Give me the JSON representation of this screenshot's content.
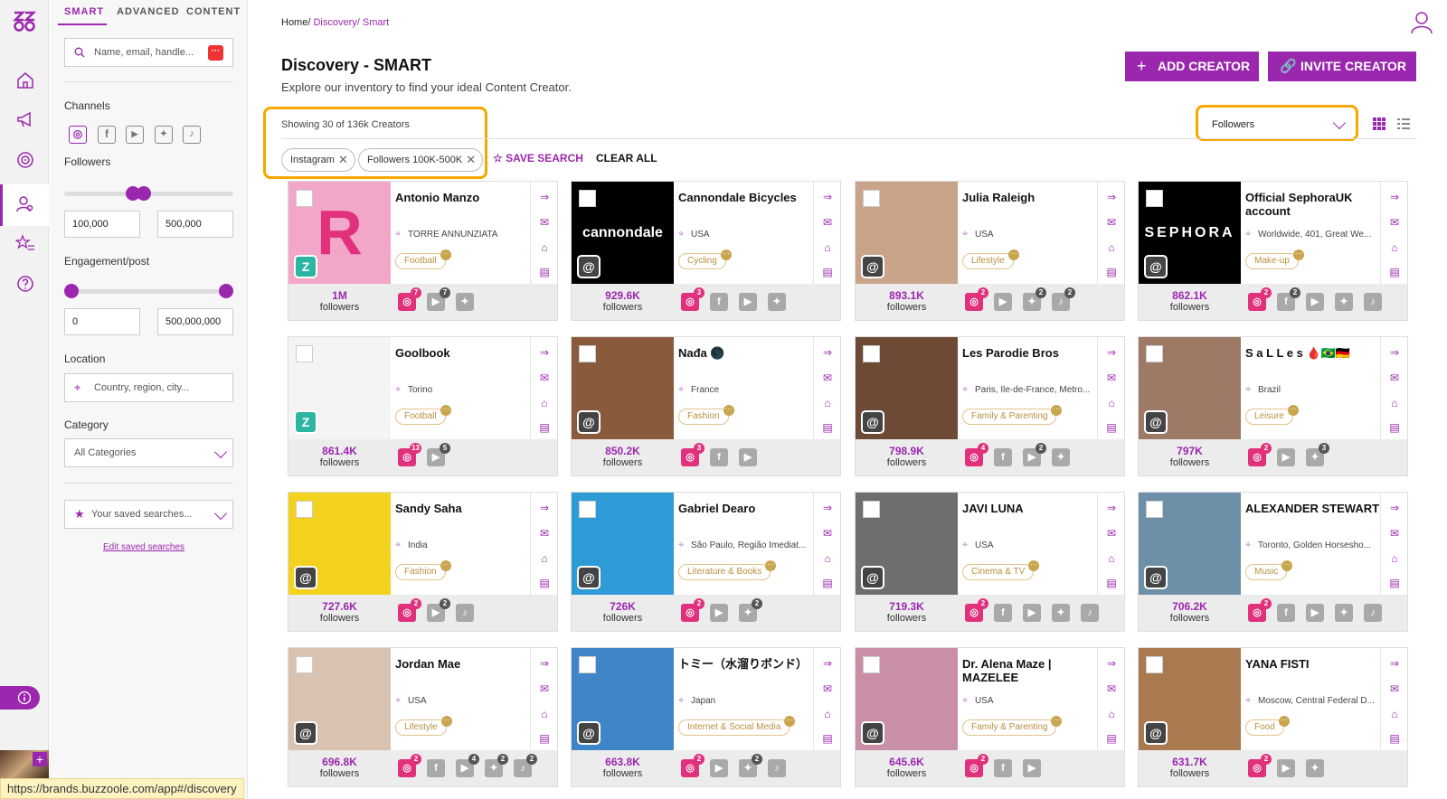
{
  "sidebar": {
    "tabs": [
      "SMART",
      "ADVANCED",
      "CONTENT"
    ],
    "search_placeholder": "Name, email, handle...",
    "channels_label": "Channels",
    "followers_label": "Followers",
    "followers_min": "100,000",
    "followers_max": "500,000",
    "engagement_label": "Engagement/post",
    "engagement_min": "0",
    "engagement_max": "500,000,000",
    "location_label": "Location",
    "location_placeholder": "Country, region, city...",
    "category_label": "Category",
    "category_value": "All Categories",
    "saved_searches": "Your saved searches...",
    "edit_saved": "Edit saved searches"
  },
  "header": {
    "breadcrumb_home": "Home/",
    "breadcrumb_discovery": " Discovery/",
    "breadcrumb_smart": " Smart",
    "title": "Discovery - SMART",
    "subtitle": "Explore our inventory to find your ideal Content Creator.",
    "add_creator": "ADD CREATOR",
    "invite_creator": "INVITE CREATOR"
  },
  "results": {
    "showing": "Showing 30 of 136k Creators",
    "chips": [
      "Instagram",
      "Followers 100K-500K"
    ],
    "save_search": "SAVE SEARCH",
    "clear_all": "CLEAR ALL",
    "sort_value": "Followers"
  },
  "followers_word": "followers",
  "colors": {
    "accent": "#9b27af",
    "highlight": "#f5a800",
    "instagram": "#e1307c"
  },
  "creators": [
    {
      "name": "Antonio Manzo",
      "location": "TORRE ANNUNZIATA",
      "category": "Football",
      "followers": "1M",
      "photo": "#f2a7c8",
      "mono": "R",
      "brand": true,
      "socials": [
        {
          "t": "ig",
          "n": "7"
        },
        {
          "t": "yt",
          "n": "7"
        },
        {
          "t": "tw",
          "n": ""
        }
      ]
    },
    {
      "name": "Cannondale Bicycles",
      "location": "USA",
      "category": "Cycling",
      "followers": "929.6K",
      "photo": "#000000",
      "mono": "cannondale",
      "brand": false,
      "socials": [
        {
          "t": "ig",
          "n": "3"
        },
        {
          "t": "fb",
          "n": ""
        },
        {
          "t": "yt",
          "n": ""
        },
        {
          "t": "tw",
          "n": ""
        }
      ]
    },
    {
      "name": "Julia Raleigh",
      "location": "USA",
      "category": "Lifestyle",
      "followers": "893.1K",
      "photo": "#c9a48a",
      "mono": "",
      "brand": false,
      "socials": [
        {
          "t": "ig",
          "n": "2"
        },
        {
          "t": "yt",
          "n": ""
        },
        {
          "t": "tw",
          "n": "2"
        },
        {
          "t": "tt",
          "n": "2"
        }
      ]
    },
    {
      "name": "Official SephoraUK account",
      "location": "Worldwide, 401, Great We...",
      "category": "Make-up",
      "followers": "862.1K",
      "photo": "#000000",
      "mono": "SEPHORA",
      "brand": false,
      "socials": [
        {
          "t": "ig",
          "n": "2"
        },
        {
          "t": "fb",
          "n": "2"
        },
        {
          "t": "yt",
          "n": ""
        },
        {
          "t": "tw",
          "n": ""
        },
        {
          "t": "tt",
          "n": ""
        }
      ]
    },
    {
      "name": "Goolbook",
      "location": "Torino",
      "category": "Football",
      "followers": "861.4K",
      "photo": "#f4f4f4",
      "mono": "",
      "brand": true,
      "socials": [
        {
          "t": "ig",
          "n": "13"
        },
        {
          "t": "yt",
          "n": "5"
        }
      ]
    },
    {
      "name": "Nađa 🌑",
      "location": "France",
      "category": "Fashion",
      "followers": "850.2K",
      "photo": "#8a5a3c",
      "mono": "",
      "brand": false,
      "socials": [
        {
          "t": "ig",
          "n": "3"
        },
        {
          "t": "fb",
          "n": ""
        },
        {
          "t": "yt",
          "n": ""
        }
      ]
    },
    {
      "name": "Les Parodie Bros",
      "location": "Paris, Ile-de-France, Metro...",
      "category": "Family & Parenting",
      "followers": "798.9K",
      "photo": "#6d4a36",
      "mono": "",
      "brand": false,
      "socials": [
        {
          "t": "ig",
          "n": "4"
        },
        {
          "t": "fb",
          "n": ""
        },
        {
          "t": "yt",
          "n": "2"
        },
        {
          "t": "tw",
          "n": ""
        }
      ]
    },
    {
      "name": "S a L L e s 🩸🇧🇷🇩🇪",
      "location": "Brazil",
      "category": "Leisure",
      "followers": "797K",
      "photo": "#9c7a66",
      "mono": "",
      "brand": false,
      "socials": [
        {
          "t": "ig",
          "n": "2"
        },
        {
          "t": "yt",
          "n": ""
        },
        {
          "t": "tw",
          "n": "3"
        }
      ]
    },
    {
      "name": "Sandy Saha",
      "location": "India",
      "category": "Fashion",
      "followers": "727.6K",
      "photo": "#f2d21e",
      "mono": "",
      "brand": false,
      "socials": [
        {
          "t": "ig",
          "n": "2"
        },
        {
          "t": "yt",
          "n": "2"
        },
        {
          "t": "tt",
          "n": ""
        }
      ]
    },
    {
      "name": "Gabriel Dearo",
      "location": "São Paulo, Região Imediat...",
      "category": "Literature & Books",
      "followers": "726K",
      "photo": "#2e9bd6",
      "mono": "",
      "brand": false,
      "socials": [
        {
          "t": "ig",
          "n": "2"
        },
        {
          "t": "yt",
          "n": ""
        },
        {
          "t": "tw",
          "n": "2"
        }
      ]
    },
    {
      "name": "JAVI LUNA",
      "location": "USA",
      "category": "Cinema & TV",
      "followers": "719.3K",
      "photo": "#6e6e6e",
      "mono": "",
      "brand": false,
      "socials": [
        {
          "t": "ig",
          "n": "2"
        },
        {
          "t": "fb",
          "n": ""
        },
        {
          "t": "yt",
          "n": ""
        },
        {
          "t": "tw",
          "n": ""
        },
        {
          "t": "tt",
          "n": ""
        }
      ]
    },
    {
      "name": "ALEXANDER STEWART",
      "location": "Toronto, Golden Horsesho...",
      "category": "Music",
      "followers": "706.2K",
      "photo": "#6d8fa8",
      "mono": "",
      "brand": false,
      "socials": [
        {
          "t": "ig",
          "n": "2"
        },
        {
          "t": "fb",
          "n": ""
        },
        {
          "t": "yt",
          "n": ""
        },
        {
          "t": "tw",
          "n": ""
        },
        {
          "t": "tt",
          "n": ""
        }
      ]
    },
    {
      "name": "Jordan Mae",
      "location": "USA",
      "category": "Lifestyle",
      "followers": "696.8K",
      "photo": "#d9c2b0",
      "mono": "",
      "brand": false,
      "socials": [
        {
          "t": "ig",
          "n": "2"
        },
        {
          "t": "fb",
          "n": ""
        },
        {
          "t": "yt",
          "n": "4"
        },
        {
          "t": "tw",
          "n": "2"
        },
        {
          "t": "tt",
          "n": "2"
        }
      ]
    },
    {
      "name": "トミー（水溜りボンド）",
      "location": "Japan",
      "category": "Internet & Social Media",
      "followers": "663.8K",
      "photo": "#3f86c9",
      "mono": "",
      "brand": false,
      "socials": [
        {
          "t": "ig",
          "n": "2"
        },
        {
          "t": "yt",
          "n": ""
        },
        {
          "t": "tw",
          "n": "2"
        },
        {
          "t": "tt",
          "n": ""
        }
      ]
    },
    {
      "name": "Dr. Alena Maze | MAZELEE",
      "location": "USA",
      "category": "Family & Parenting",
      "followers": "645.6K",
      "photo": "#c98fa6",
      "mono": "",
      "brand": false,
      "socials": [
        {
          "t": "ig",
          "n": "2"
        },
        {
          "t": "fb",
          "n": ""
        },
        {
          "t": "yt",
          "n": ""
        }
      ]
    },
    {
      "name": "YANA FISTI",
      "location": "Moscow, Central Federal D...",
      "category": "Food",
      "followers": "631.7K",
      "photo": "#a9794f",
      "mono": "",
      "brand": false,
      "socials": [
        {
          "t": "ig",
          "n": "2"
        },
        {
          "t": "yt",
          "n": ""
        },
        {
          "t": "tw",
          "n": ""
        }
      ]
    }
  ],
  "status_url": "https://brands.buzzoole.com/app#/discovery"
}
